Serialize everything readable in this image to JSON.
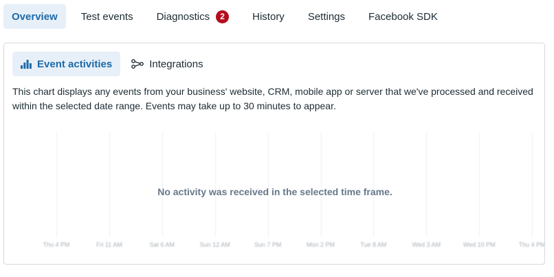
{
  "top_tabs": [
    {
      "label": "Overview",
      "active": true
    },
    {
      "label": "Test events"
    },
    {
      "label": "Diagnostics",
      "badge": "2"
    },
    {
      "label": "History"
    },
    {
      "label": "Settings"
    },
    {
      "label": "Facebook SDK"
    }
  ],
  "sub_tabs": [
    {
      "label": "Event activities",
      "icon": "bar-chart-icon",
      "active": true
    },
    {
      "label": "Integrations",
      "icon": "integrations-icon"
    }
  ],
  "description": "This chart displays any events from your business' website, CRM, mobile app or server that we've processed and received within the selected date range. Events may take up to 30 minutes to appear.",
  "chart": {
    "empty_message": "No activity was received in the selected time frame.",
    "y_tick": "",
    "x_labels": [
      "Thu 4 PM",
      "Fri 11 AM",
      "Sat 6 AM",
      "Sun 12 AM",
      "Sun 7 PM",
      "Mon 2 PM",
      "Tue 8 AM",
      "Wed 3 AM",
      "Wed 10 PM",
      "Thu 4 PM"
    ]
  },
  "colors": {
    "accent": "#1d6aa8",
    "accent_bg": "#e7f0f8",
    "badge": "#b30d1d",
    "text": "#1c2b33",
    "muted": "#67788a"
  }
}
